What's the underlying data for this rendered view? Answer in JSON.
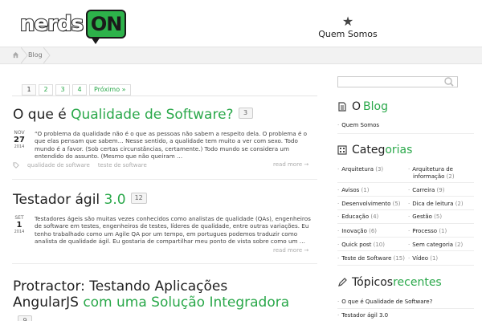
{
  "header": {
    "logo_part1": "nerds",
    "logo_part2": "ON",
    "menu_label": "Quem Somos",
    "menu_icon": "star-icon"
  },
  "breadcrumb": {
    "home_icon": "home-icon",
    "current": "Blog"
  },
  "pagination": {
    "pages": [
      "1",
      "2",
      "3",
      "4"
    ],
    "next": "Próximo »"
  },
  "posts": [
    {
      "title_plain": "O que é ",
      "title_highlight": "Qualidade de Software?",
      "comments": "3",
      "date": {
        "month": "NOV",
        "day": "27",
        "year": "2014"
      },
      "excerpt": "“O problema da qualidade não é o que as pessoas não sabem a respeito dela. O problema é o que elas pensam que sabem… Nesse sentido, a qualidade tem muito a ver com sexo. Todo mundo é a favor. (Sob certas circunstâncias, certamente.) Todo mundo se considera um entendido do assunto. (Mesmo que não queiram …",
      "tags": [
        "qualidade de software",
        "teste de software"
      ],
      "read_more": "read more →"
    },
    {
      "title_plain": "Testador ágil ",
      "title_highlight": "3.0",
      "comments": "12",
      "date": {
        "month": "SET",
        "day": "1",
        "year": "2014"
      },
      "excerpt": "Testadores ágeis são muitas vezes conhecidos como analistas de qualidade (QAs), engenheiros de software em testes, engenheiros de testes, líderes de qualidade, entre outras variações. Eu tenho trabalhado como um Agile QA por um tempo, em portugues podemos traduzir como analista de qualidade ágil. Eu gostaria de compartilhar meu ponto de vista sobre como um …",
      "read_more": "read more →"
    },
    {
      "title_line1": "Protractor: Testando Aplicações",
      "title_line2_plain": "AngularJS ",
      "title_line2_highlight": "com uma Solução Integradora",
      "comments": "9"
    }
  ],
  "sidebar": {
    "blog_widget": {
      "title_plain": "O ",
      "title_highlight": "Blog",
      "items": [
        "Quem Somos"
      ]
    },
    "categories_widget": {
      "title_plain": "Categ",
      "title_highlight": "orias",
      "left": [
        {
          "label": "Arquitetura",
          "count": "(3)"
        },
        {
          "label": "Avisos",
          "count": "(1)"
        },
        {
          "label": "Desenvolvimento",
          "count": "(5)"
        },
        {
          "label": "Educação",
          "count": "(4)"
        },
        {
          "label": "Inovação",
          "count": "(6)"
        },
        {
          "label": "Quick post",
          "count": "(10)"
        },
        {
          "label": "Teste de Software",
          "count": "(15)"
        }
      ],
      "right": [
        {
          "label": "Arquitetura de",
          "label2": "informação",
          "count": "(2)"
        },
        {
          "label": "Carreira",
          "count": "(9)"
        },
        {
          "label": "Dica de leitura",
          "count": "(2)"
        },
        {
          "label": "Gestão",
          "count": "(5)"
        },
        {
          "label": "Processo",
          "count": "(1)"
        },
        {
          "label": "Sem categoria",
          "count": "(2)"
        },
        {
          "label": "Vídeo",
          "count": "(1)"
        }
      ]
    },
    "recent_widget": {
      "title_plain": "Tópicos ",
      "title_highlight": "recentes",
      "items": [
        "O que é Qualidade de Software?",
        "Testador ágil 3.0"
      ]
    }
  },
  "colors": {
    "accent": "#2aa84a",
    "logo_green": "#2db24a",
    "text": "#222222"
  }
}
